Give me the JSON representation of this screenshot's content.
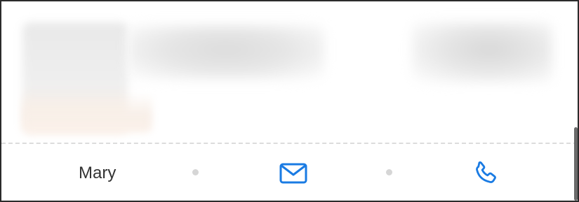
{
  "contact": {
    "name": "Mary"
  },
  "actions": {
    "email_icon": "mail-icon",
    "phone_icon": "phone-icon"
  },
  "colors": {
    "accent": "#1a7be3",
    "text": "#333333",
    "separator_dot": "#d6d6d6"
  }
}
